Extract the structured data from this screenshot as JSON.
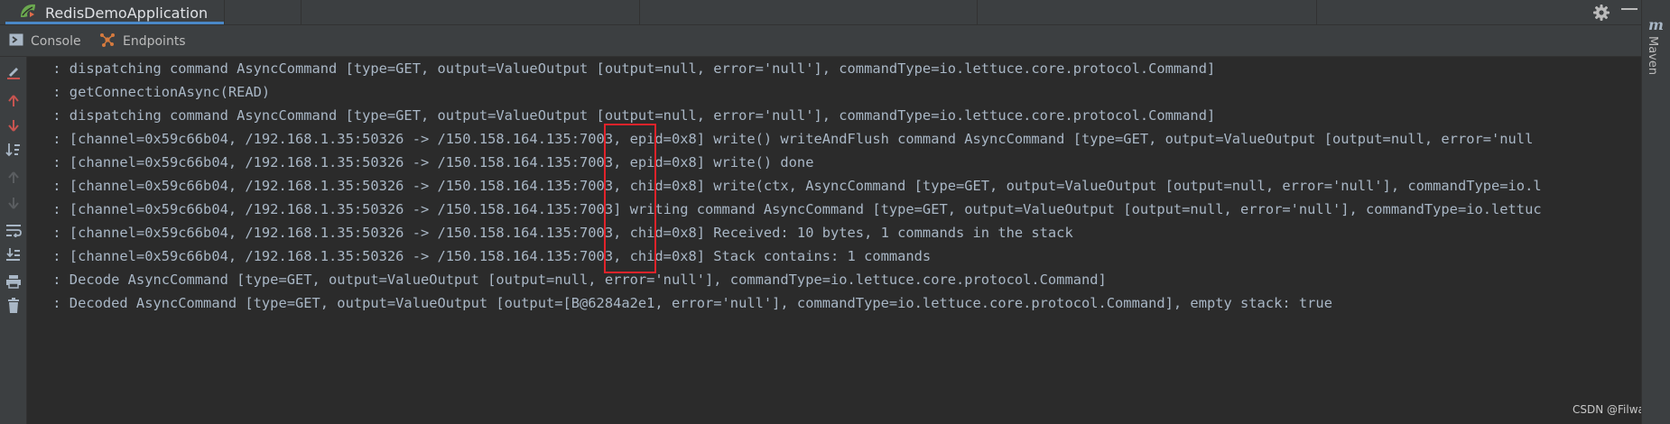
{
  "run_tab": {
    "title": "RedisDemoApplication",
    "icon": "spring-boot-run-icon"
  },
  "header_actions": {
    "settings_icon": "gear-icon",
    "minimize_icon": "minimize-icon"
  },
  "subtabs": [
    {
      "label": "Console",
      "icon": "console-icon"
    },
    {
      "label": "Endpoints",
      "icon": "endpoints-icon"
    }
  ],
  "gutter_tools": [
    "edit-configuration-icon",
    "up-arrow-icon",
    "down-arrow-icon",
    "sort-icon",
    "up-disabled-icon",
    "down-disabled-icon",
    "soft-wrap-icon",
    "scroll-to-end-icon",
    "print-icon",
    "clear-all-icon"
  ],
  "console": {
    "lines": [
      " : dispatching command AsyncCommand [type=GET, output=ValueOutput [output=null, error='null'], commandType=io.lettuce.core.protocol.Command]",
      " : getConnectionAsync(READ)",
      " : dispatching command AsyncCommand [type=GET, output=ValueOutput [output=null, error='null'], commandType=io.lettuce.core.protocol.Command]",
      " : [channel=0x59c66b04, /192.168.1.35:50326 -> /150.158.164.135:7003, epid=0x8] write() writeAndFlush command AsyncCommand [type=GET, output=ValueOutput [output=null, error='null",
      " : [channel=0x59c66b04, /192.168.1.35:50326 -> /150.158.164.135:7003, epid=0x8] write() done",
      " : [channel=0x59c66b04, /192.168.1.35:50326 -> /150.158.164.135:7003, chid=0x8] write(ctx, AsyncCommand [type=GET, output=ValueOutput [output=null, error='null'], commandType=io.l",
      " : [channel=0x59c66b04, /192.168.1.35:50326 -> /150.158.164.135:7003] writing command AsyncCommand [type=GET, output=ValueOutput [output=null, error='null'], commandType=io.lettuc",
      " : [channel=0x59c66b04, /192.168.1.35:50326 -> /150.158.164.135:7003, chid=0x8] Received: 10 bytes, 1 commands in the stack",
      " : [channel=0x59c66b04, /192.168.1.35:50326 -> /150.158.164.135:7003, chid=0x8] Stack contains: 1 commands",
      " : Decode AsyncCommand [type=GET, output=ValueOutput [output=null, error='null'], commandType=io.lettuce.core.protocol.Command]",
      " : Decoded AsyncCommand [type=GET, output=ValueOutput [output=[B@6284a2e1, error='null'], commandType=io.lettuce.core.protocol.Command], empty stack: true"
    ]
  },
  "right_stripe": {
    "icon_text": "m",
    "label": "Maven"
  },
  "watermark": "CSDN @Filwaod",
  "colors": {
    "highlight_box": "#e2232a",
    "active_tab_underline": "#4a88c7",
    "console_text": "#a9b7c6"
  }
}
